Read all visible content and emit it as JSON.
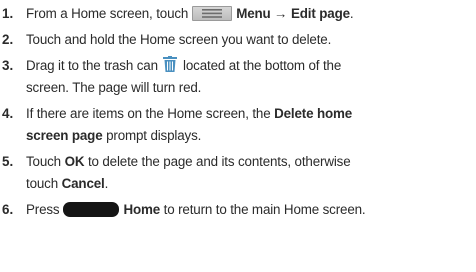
{
  "steps": [
    {
      "number": "1.",
      "parts": {
        "a": "From a Home screen, touch",
        "menu_icon": "menu-key-icon",
        "b": "Menu",
        "arrow": "→",
        "c": "Edit page",
        "d": "."
      }
    },
    {
      "number": "2.",
      "parts": {
        "a": "Touch and hold the Home screen you want to delete."
      }
    },
    {
      "number": "3.",
      "parts": {
        "a": "Drag it to the trash can",
        "trash_icon": "trash-can-icon",
        "b": "located at the bottom of the",
        "c": "screen. The page will turn red."
      }
    },
    {
      "number": "4.",
      "parts": {
        "a": "If there are items on the Home screen, the",
        "b": "Delete home",
        "c": "screen page",
        "d": "prompt displays."
      }
    },
    {
      "number": "5.",
      "parts": {
        "a": "Touch",
        "b": "OK",
        "c": "to delete the page and its contents, otherwise",
        "d": "touch",
        "e": "Cancel",
        "f": "."
      }
    },
    {
      "number": "6.",
      "parts": {
        "a": "Press",
        "home_icon": "home-key-icon",
        "b": "Home",
        "c": "to return to the main Home screen."
      }
    }
  ],
  "colors": {
    "text": "#2b2b2b",
    "menu_key": "#c8c8c8",
    "home_key": "#151515",
    "trash_icon": "#4a90c0"
  }
}
